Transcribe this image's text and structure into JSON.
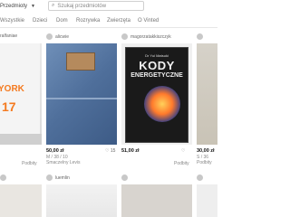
{
  "header": {
    "category": "Przedmioty",
    "search_placeholder": "Szukaj przedmiotów"
  },
  "nav": [
    "Wszystkie",
    "Dzieci",
    "Dom",
    "Rozrywka",
    "Zwierzęta",
    "O Vinted"
  ],
  "cards": [
    {
      "user": "ralfaniae",
      "likes": "",
      "price": "",
      "meta1": "",
      "meta2": "Podbity"
    },
    {
      "user": "alicwie",
      "likes": "15",
      "price": "50,00 zł",
      "meta1": "M / 38 / 10",
      "meta2": "Smaczelny Levis"
    },
    {
      "user": "magorzatakkiszczyk",
      "likes": "",
      "price": "51,00 zł",
      "meta1": "",
      "meta2": "Podbity"
    },
    {
      "user": "",
      "likes": "",
      "price": "30,00 zł",
      "meta1": "S / 36",
      "meta2": "Podbity"
    }
  ],
  "book": {
    "author": "Dr Yui Matsuki",
    "title": "KODY",
    "subtitle": "ENERGETYCZNE"
  },
  "row2_users": [
    "",
    "luemlin",
    "",
    "bnszwieki",
    ""
  ]
}
